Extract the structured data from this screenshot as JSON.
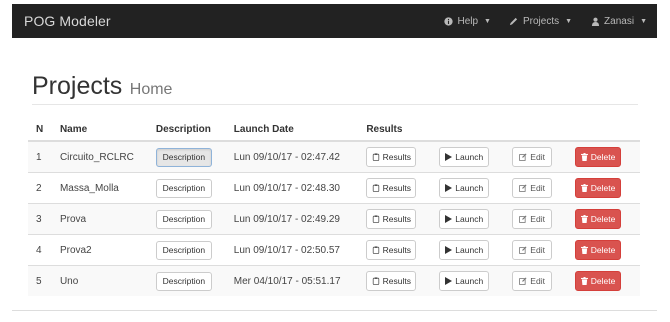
{
  "navbar": {
    "brand": "POG Modeler",
    "help_label": "Help",
    "projects_label": "Projects",
    "user_label": "Zanasi"
  },
  "header": {
    "title": "Projects",
    "subtitle": "Home"
  },
  "table": {
    "columns": {
      "n": "N",
      "name": "Name",
      "description": "Description",
      "launch_date": "Launch Date",
      "results": "Results"
    },
    "rows": [
      {
        "n": "1",
        "name": "Circuito_RCLRC",
        "date": "Lun 09/10/17 - 02:47.42"
      },
      {
        "n": "2",
        "name": "Massa_Molla",
        "date": "Lun 09/10/17 - 02:48.30"
      },
      {
        "n": "3",
        "name": "Prova",
        "date": "Lun 09/10/17 - 02:49.29"
      },
      {
        "n": "4",
        "name": "Prova2",
        "date": "Lun 09/10/17 - 02:50.57"
      },
      {
        "n": "5",
        "name": "Uno",
        "date": "Mer 04/10/17 - 05:51.17"
      }
    ],
    "buttons": {
      "description": "Description",
      "results": "Results",
      "launch": "Launch",
      "edit": "Edit",
      "delete": "Delete"
    }
  },
  "colors": {
    "navbar_bg": "#222222",
    "delete_bg": "#d9534f",
    "stripe_bg": "#f9f9f9"
  }
}
